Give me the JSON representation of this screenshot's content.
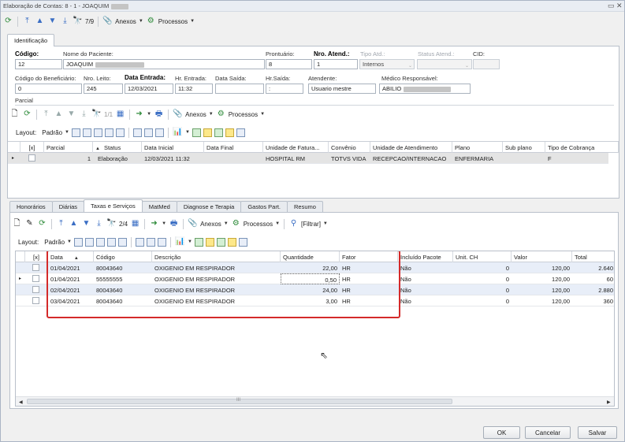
{
  "window": {
    "title": "Elaboração de Contas: 8 - 1 - JOAQUIM",
    "close_glyph": "✕",
    "restore_glyph": "▭"
  },
  "top_toolbar": {
    "record_counter": "7/9",
    "anexos": "Anexos",
    "processos": "Processos"
  },
  "main_tab": "Identificação",
  "ident": {
    "codigo_label": "Código:",
    "codigo": "12",
    "nome_label": "Nome do Paciente:",
    "nome": "JOAQUIM",
    "prontuario_label": "Prontuário:",
    "prontuario": "8",
    "nro_atend_label": "Nro. Atend.:",
    "nro_atend": "1",
    "tipo_atd_label": "Tipo Atd.:",
    "tipo_atd": "Internos",
    "status_atend_label": "Status Atend.:",
    "status_atend": "",
    "cid_label": "CID:",
    "cid": "",
    "cod_benef_label": "Código do Beneficiário:",
    "cod_benef": "0",
    "nro_leito_label": "Nro. Leito:",
    "nro_leito": "245",
    "data_entrada_label": "Data Entrada:",
    "data_entrada": "12/03/2021",
    "hr_entrada_label": "Hr. Entrada:",
    "hr_entrada": "11:32",
    "data_saida_label": "Data Saída:",
    "data_saida": "",
    "hr_saida_label": "Hr.Saída:",
    "hr_saida": ":",
    "atendente_label": "Atendente:",
    "atendente": "Usuario mestre",
    "medico_label": "Médico Responsável:",
    "medico": "ABILIO"
  },
  "parcial": {
    "section_label": "Parcial",
    "counter": "1/1",
    "anexos": "Anexos",
    "processos": "Processos",
    "layout_label": "Layout:",
    "layout_value": "Padrão",
    "columns": [
      "[x]",
      "Parcial",
      "Status",
      "Data Inicial",
      "Data Final",
      "Unidade de Fatura...",
      "Convênio",
      "Unidade de Atendimento",
      "Plano",
      "Sub plano",
      "Tipo de Cobrança"
    ],
    "row": {
      "parcial": "1",
      "status": "Elaboração",
      "data_inicial": "12/03/2021 11:32",
      "data_final": "",
      "unidade_fatura": "HOSPITAL RM",
      "convenio": "TOTVS VIDA",
      "unidade_atendimento": "RECEPCAO/INTERNACAO",
      "plano": "ENFERMARIA",
      "sub_plano": "",
      "tipo_cobranca": "F"
    }
  },
  "lower_tabs": [
    "Honorários",
    "Diárias",
    "Taxas e Serviços",
    "MatMed",
    "Diagnose e Terapia",
    "Gastos Part.",
    "Resumo"
  ],
  "lower_active_tab": "Taxas e Serviços",
  "taxas": {
    "counter": "2/4",
    "anexos": "Anexos",
    "processos": "Processos",
    "filtrar": "[Filtrar]",
    "layout_label": "Layout:",
    "layout_value": "Padrão",
    "columns": [
      "[x]",
      "Data",
      "Código",
      "Descrição",
      "Quantidade",
      "Fator",
      "Incluído Pacote",
      "Unit. CH",
      "Valor",
      "Total"
    ],
    "rows": [
      {
        "data": "01/04/2021",
        "codigo": "80043640",
        "descricao": "OXIGENIO EM RESPIRADOR",
        "quantidade": "22,00",
        "fator": "HR",
        "incluido": "Não",
        "unit_ch": "0",
        "valor": "120,00",
        "total": "2.640"
      },
      {
        "data": "01/04/2021",
        "codigo": "55555555",
        "descricao": "OXIGENIO EM RESPIRADOR",
        "quantidade": "0,50",
        "fator": "HR",
        "incluido": "Não",
        "unit_ch": "0",
        "valor": "120,00",
        "total": "60"
      },
      {
        "data": "02/04/2021",
        "codigo": "80043640",
        "descricao": "OXIGENIO EM RESPIRADOR",
        "quantidade": "24,00",
        "fator": "HR",
        "incluido": "Não",
        "unit_ch": "0",
        "valor": "120,00",
        "total": "2.880"
      },
      {
        "data": "03/04/2021",
        "codigo": "80043640",
        "descricao": "OXIGENIO EM RESPIRADOR",
        "quantidade": "3,00",
        "fator": "HR",
        "incluido": "Não",
        "unit_ch": "0",
        "valor": "120,00",
        "total": "360"
      }
    ],
    "scroll_mark": "III"
  },
  "footer": {
    "ok": "OK",
    "cancelar": "Cancelar",
    "salvar": "Salvar"
  }
}
